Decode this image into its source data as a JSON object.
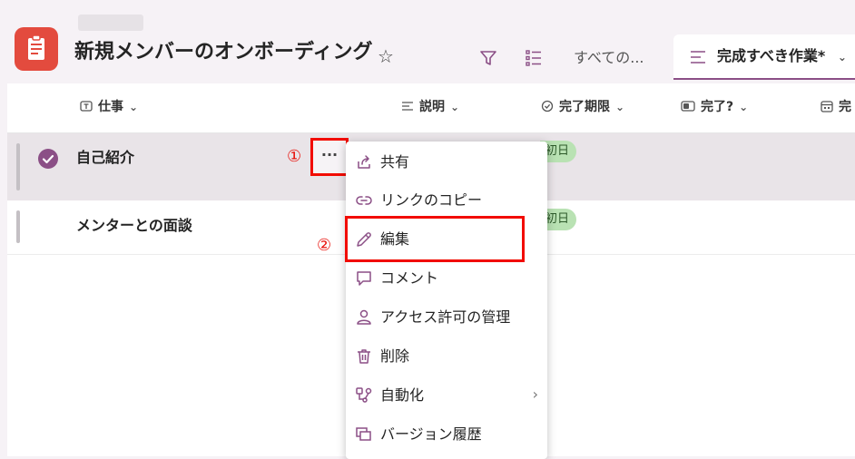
{
  "header": {
    "list_title": "新規メンバーのオンボーディング",
    "view_tab_all": "すべての...",
    "active_view": "完成すべき作業*",
    "chevron": "⌄",
    "star": "☆"
  },
  "columns": [
    {
      "label": "仕事",
      "chevron": "⌄"
    },
    {
      "label": "説明",
      "chevron": "⌄"
    },
    {
      "label": "完了期限",
      "chevron": "⌄"
    },
    {
      "label": "完了?",
      "chevron": "⌄"
    },
    {
      "label": "完"
    }
  ],
  "rows": [
    {
      "task": "自己紹介",
      "due": "初日"
    },
    {
      "task": "メンターとの面談",
      "due": "初日"
    }
  ],
  "more_button": "···",
  "annotations": {
    "step1": "①",
    "step2": "②"
  },
  "menu": {
    "items": [
      {
        "label": "共有",
        "icon": "share-icon"
      },
      {
        "label": "リンクのコピー",
        "icon": "link-icon"
      },
      {
        "label": "編集",
        "icon": "pencil-icon"
      },
      {
        "label": "コメント",
        "icon": "comment-icon"
      },
      {
        "label": "アクセス許可の管理",
        "icon": "person-icon"
      },
      {
        "label": "削除",
        "icon": "trash-icon"
      },
      {
        "label": "自動化",
        "icon": "automate-icon",
        "submenu_arrow": "›"
      },
      {
        "label": "バージョン履歴",
        "icon": "version-history-icon"
      }
    ]
  },
  "colors": {
    "accent": "#8b4f86",
    "app_icon": "#e34b3e",
    "annotation_red": "#f20c00",
    "pill_green": "#b9e2b3"
  }
}
